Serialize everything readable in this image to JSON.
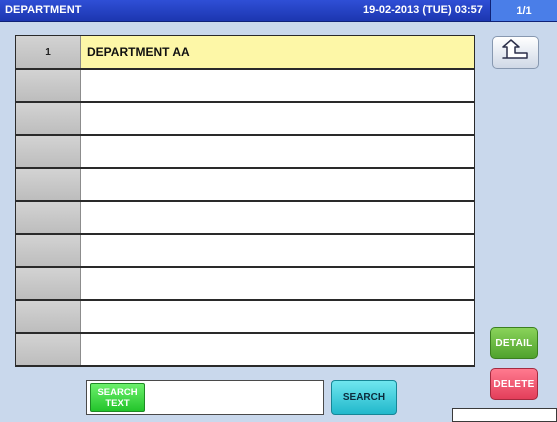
{
  "header": {
    "title": "DEPARTMENT",
    "datetime": "19-02-2013 (TUE) 03:57",
    "page": "1/1"
  },
  "table": {
    "rows": [
      {
        "num": "1",
        "name": "DEPARTMENT AA",
        "selected": true
      },
      {
        "num": "",
        "name": ""
      },
      {
        "num": "",
        "name": ""
      },
      {
        "num": "",
        "name": ""
      },
      {
        "num": "",
        "name": ""
      },
      {
        "num": "",
        "name": ""
      },
      {
        "num": "",
        "name": ""
      },
      {
        "num": "",
        "name": ""
      },
      {
        "num": "",
        "name": ""
      },
      {
        "num": "",
        "name": ""
      }
    ]
  },
  "buttons": {
    "back_icon": "return-arrow-icon",
    "detail": "DETAIL",
    "delete": "DELETE",
    "search": "SEARCH"
  },
  "search": {
    "label_line1": "SEARCH",
    "label_line2": "TEXT",
    "value": ""
  },
  "colors": {
    "header_bg": "#2438c4",
    "page_bg": "#c9d8ec",
    "selected_row": "#fdf7a7",
    "detail_green": "#5cb336",
    "delete_red": "#ee4d68",
    "search_cyan": "#37c8d8",
    "search_text_green": "#2fd13a"
  }
}
